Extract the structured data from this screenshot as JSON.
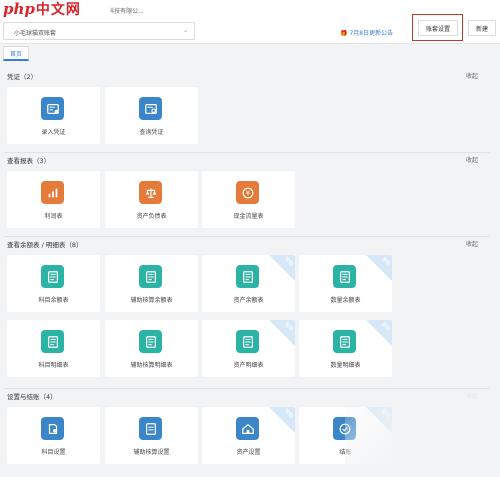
{
  "logo": {
    "php": "php",
    "cn": "中文网"
  },
  "header": {
    "title": "务-杭州小毛球猫科技有限公...",
    "account_select": "小毛球猫双账套",
    "notice": "7月8日更新公告",
    "account_settings": "账套设置",
    "new_button": "新建"
  },
  "tabs": [
    {
      "label": "首页"
    }
  ],
  "collapse_label": "收起",
  "sections": [
    {
      "title": "凭证（2）",
      "cards": [
        {
          "label": "录入凭证",
          "icon": "voucher-entry-icon",
          "color": "blue",
          "tag": ""
        },
        {
          "label": "查询凭证",
          "icon": "voucher-query-icon",
          "color": "blue",
          "tag": ""
        }
      ]
    },
    {
      "title": "查看报表（3）",
      "cards": [
        {
          "label": "利润表",
          "icon": "bar-chart-icon",
          "color": "orange",
          "tag": ""
        },
        {
          "label": "资产负债表",
          "icon": "balance-scale-icon",
          "color": "orange",
          "tag": ""
        },
        {
          "label": "现金流量表",
          "icon": "coin-icon",
          "color": "orange",
          "tag": ""
        }
      ]
    },
    {
      "title": "查看余额表 / 明细表（8）",
      "cards": [
        {
          "label": "科目余额表",
          "icon": "ledger-icon",
          "color": "teal",
          "tag": ""
        },
        {
          "label": "辅助核算余额表",
          "icon": "ledger-icon",
          "color": "teal",
          "tag": ""
        },
        {
          "label": "资产余额表",
          "icon": "ledger-icon",
          "color": "teal",
          "tag": "智能"
        },
        {
          "label": "数量余额表",
          "icon": "ledger-icon",
          "color": "teal",
          "tag": "智能"
        },
        {
          "label": "科目明细表",
          "icon": "ledger-icon",
          "color": "teal",
          "tag": ""
        },
        {
          "label": "辅助核算明细表",
          "icon": "ledger-icon",
          "color": "teal",
          "tag": ""
        },
        {
          "label": "资产明细表",
          "icon": "ledger-icon",
          "color": "teal",
          "tag": "智能"
        },
        {
          "label": "数量明细表",
          "icon": "ledger-icon",
          "color": "teal",
          "tag": "智能"
        }
      ]
    },
    {
      "title": "设置与结账（4）",
      "cards": [
        {
          "label": "科目设置",
          "icon": "subject-settings-icon",
          "color": "blue",
          "tag": ""
        },
        {
          "label": "辅助核算设置",
          "icon": "aux-settings-icon",
          "color": "blue",
          "tag": ""
        },
        {
          "label": "资产设置",
          "icon": "asset-settings-icon",
          "color": "blue",
          "tag": "智能"
        },
        {
          "label": "结账",
          "icon": "closing-icon",
          "color": "blue",
          "tag": "智能"
        }
      ]
    }
  ]
}
